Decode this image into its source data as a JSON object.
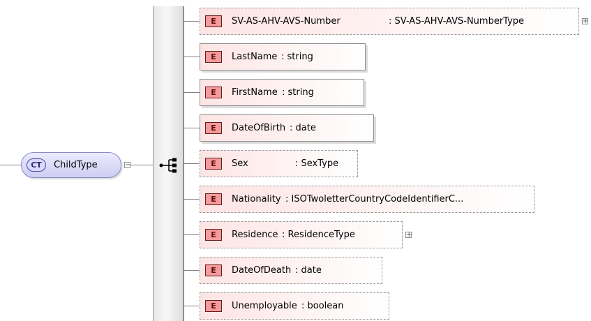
{
  "complex_type": {
    "badge": "CT",
    "name": "ChildType"
  },
  "element_badge": "E",
  "elements": [
    {
      "name": "SV-AS-AHV-AVS-Number",
      "type": "SV-AS-AHV-AVS-NumberType",
      "required": false,
      "expandable": true
    },
    {
      "name": "LastName",
      "type": "string",
      "required": true,
      "expandable": false
    },
    {
      "name": "FirstName",
      "type": "string",
      "required": true,
      "expandable": false
    },
    {
      "name": "DateOfBirth",
      "type": "date",
      "required": true,
      "expandable": false
    },
    {
      "name": "Sex",
      "type": "SexType",
      "required": false,
      "expandable": false
    },
    {
      "name": "Nationality",
      "type": "ISOTwoletterCountryCodeIdentifierC...",
      "required": false,
      "expandable": false
    },
    {
      "name": "Residence",
      "type": "ResidenceType",
      "required": false,
      "expandable": true
    },
    {
      "name": "DateOfDeath",
      "type": "date",
      "required": false,
      "expandable": false
    },
    {
      "name": "Unemployable",
      "type": "boolean",
      "required": false,
      "expandable": false
    }
  ],
  "colors": {
    "element_badge": "#f39a9a",
    "complex_type_fill": "#dcdaf8",
    "lines": "#808080"
  }
}
